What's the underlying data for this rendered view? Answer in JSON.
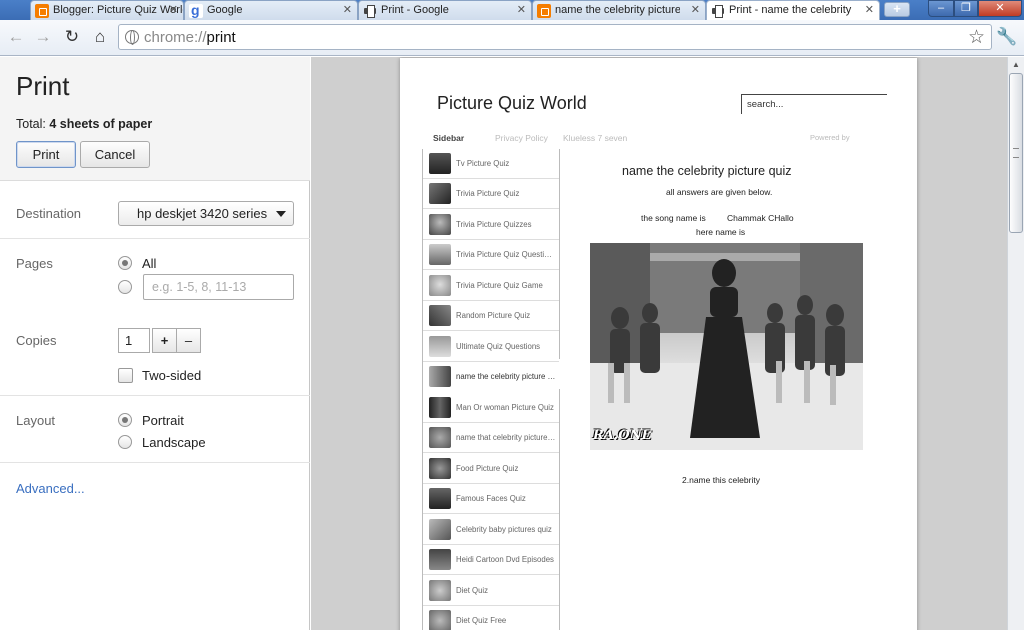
{
  "tabs": [
    {
      "label": "Blogger: Picture Quiz World",
      "icon": "blogger-icon"
    },
    {
      "label": "Google",
      "icon": "google-icon"
    },
    {
      "label": "Print - Google",
      "icon": "printer-icon"
    },
    {
      "label": "name the celebrity picture",
      "icon": "blogger-icon"
    },
    {
      "label": "Print - name the celebrity p",
      "icon": "printer-icon",
      "active": true
    }
  ],
  "address": {
    "scheme": "chrome://",
    "host": "print"
  },
  "print": {
    "title": "Print",
    "total_label": "Total:",
    "total_value": "4 sheets of paper",
    "print_button": "Print",
    "cancel_button": "Cancel",
    "destination_label": "Destination",
    "destination_value": "hp deskjet 3420 series",
    "pages_label": "Pages",
    "pages_all": "All",
    "pages_placeholder": "e.g. 1-5, 8, 11-13",
    "copies_label": "Copies",
    "copies_value": "1",
    "plus": "+",
    "minus": "–",
    "two_sided": "Two-sided",
    "layout_label": "Layout",
    "portrait": "Portrait",
    "landscape": "Landscape",
    "advanced": "Advanced..."
  },
  "page": {
    "site_title": "Picture Quiz World",
    "search_placeholder": "search...",
    "nav": {
      "sidebar": "Sidebar",
      "privacy": "Privacy Policy",
      "klueless": "Klueless 7 seven",
      "powered": "Powered by"
    },
    "sidebar_items": [
      "Tv Picture Quiz",
      "Trivia Picture Quiz",
      "Trivia Picture Quizzes",
      "Trivia Picture Quiz Questions",
      "Trivia Picture Quiz Game",
      "Random Picture Quiz",
      "Ultimate Quiz Questions",
      "name the celebrity picture quiz",
      "Man Or woman Picture Quiz",
      "name that celebrity picture quiz",
      "Food Picture Quiz",
      "Famous Faces Quiz",
      "Celebrity baby pictures quiz",
      "Heidi Cartoon Dvd Episodes",
      "Diet Quiz",
      "Diet Quiz Free"
    ],
    "post_title": "name the celebrity picture quiz",
    "answers_note": "all answers are given below.",
    "song_label": "the song name is",
    "song_value": "Chammak CHallo",
    "here_name": "here name is",
    "photo_logo": "RA.ONE",
    "caption": "2.name this celebrity"
  },
  "colors": {
    "tab_bar": "#3b6db5",
    "link": "#3a6fc0",
    "preview_bg": "#cfcfcf"
  }
}
